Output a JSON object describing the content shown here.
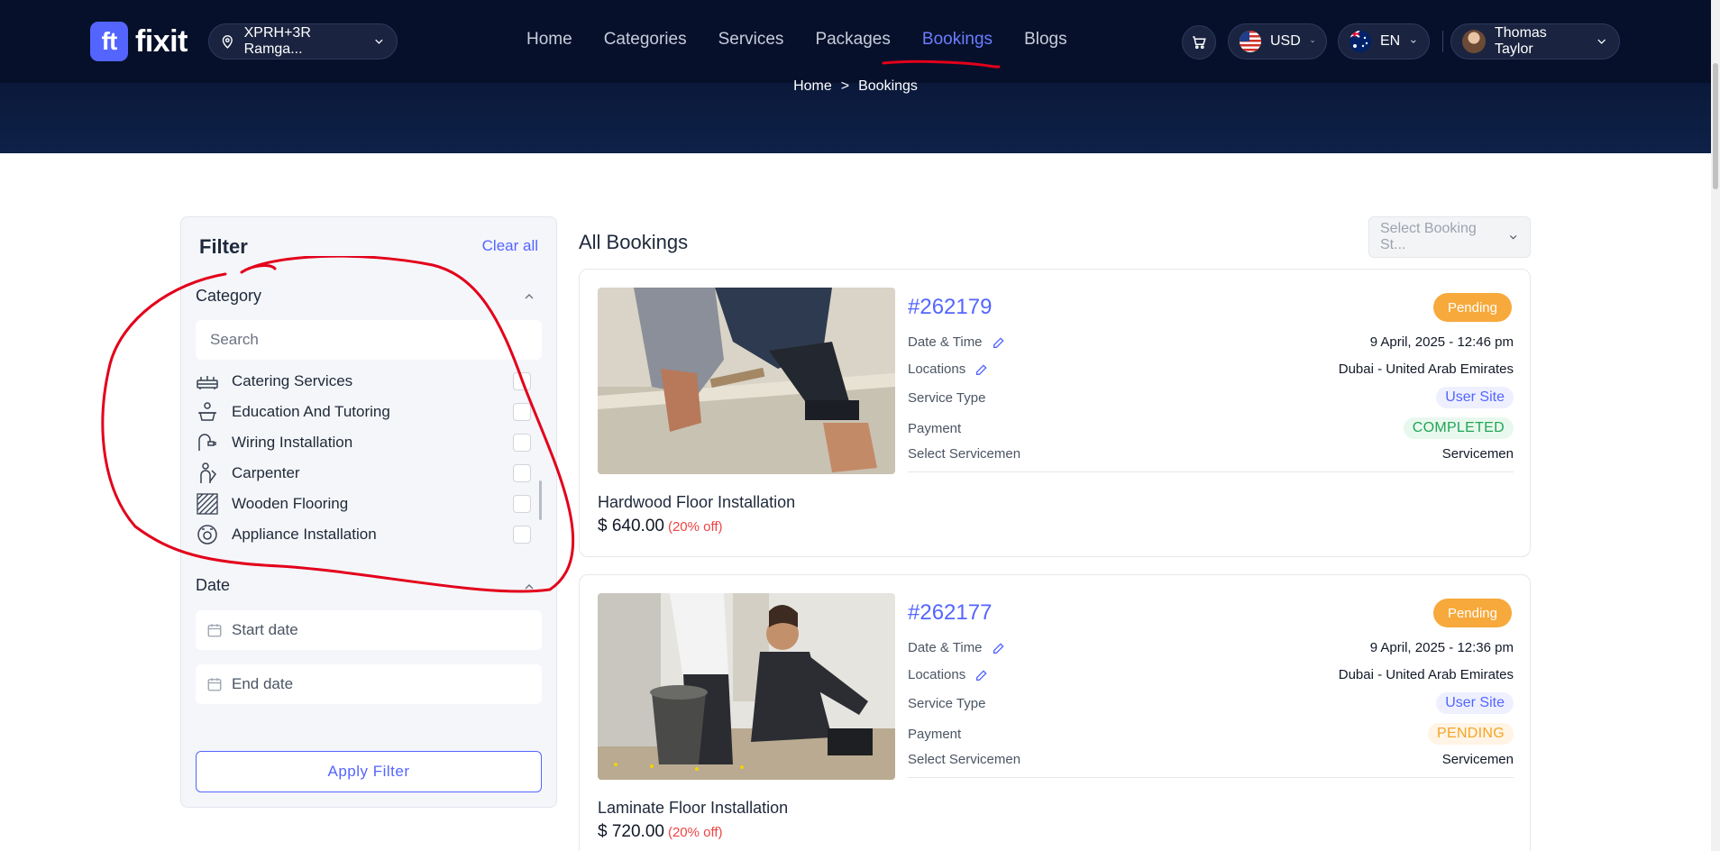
{
  "header": {
    "logo_mark": "ft",
    "logo_text": "fixit",
    "location": "XPRH+3R Ramga...",
    "nav": [
      "Home",
      "Categories",
      "Services",
      "Packages",
      "Bookings",
      "Blogs"
    ],
    "active_nav": "Bookings",
    "currency": "USD",
    "language": "EN",
    "user_name": "Thomas Taylor"
  },
  "breadcrumb": {
    "home": "Home",
    "separator": ">",
    "current": "Bookings"
  },
  "filter": {
    "title": "Filter",
    "clear_all": "Clear all",
    "category_title": "Category",
    "search_placeholder": "Search",
    "categories": [
      {
        "label": "Catering Services",
        "icon": "catering-icon"
      },
      {
        "label": "Education And Tutoring",
        "icon": "education-icon"
      },
      {
        "label": "Wiring Installation",
        "icon": "wiring-icon"
      },
      {
        "label": "Carpenter",
        "icon": "carpenter-icon"
      },
      {
        "label": "Wooden Flooring",
        "icon": "flooring-icon"
      },
      {
        "label": "Appliance Installation",
        "icon": "appliance-icon"
      }
    ],
    "date_title": "Date",
    "start_placeholder": "Start date",
    "end_placeholder": "End date",
    "apply_label": "Apply Filter"
  },
  "bookings": {
    "title": "All Bookings",
    "status_select": "Select Booking St...",
    "labels": {
      "date_time": "Date & Time",
      "locations": "Locations",
      "service_type": "Service Type",
      "payment": "Payment",
      "servicemen": "Select Servicemen"
    },
    "items": [
      {
        "id": "#262179",
        "status": "Pending",
        "date_time": "9 April, 2025 - 12:46 pm",
        "location": "Dubai - United Arab Emirates",
        "service_type": "User Site",
        "payment": "COMPLETED",
        "servicemen": "Servicemen",
        "service_name": "Hardwood Floor Installation",
        "price": "$ 640.00",
        "discount": "(20% off)"
      },
      {
        "id": "#262177",
        "status": "Pending",
        "date_time": "9 April, 2025 - 12:36 pm",
        "location": "Dubai - United Arab Emirates",
        "service_type": "User Site",
        "payment": "PENDING",
        "servicemen": "Servicemen",
        "service_name": "Laminate Floor Installation",
        "price": "$ 720.00",
        "discount": "(20% off)"
      }
    ]
  },
  "colors": {
    "navy": "#06102a",
    "accent": "#5465ff",
    "pending": "#f7a93b",
    "completed": "#1fa655",
    "annotation": "#e3001b"
  }
}
